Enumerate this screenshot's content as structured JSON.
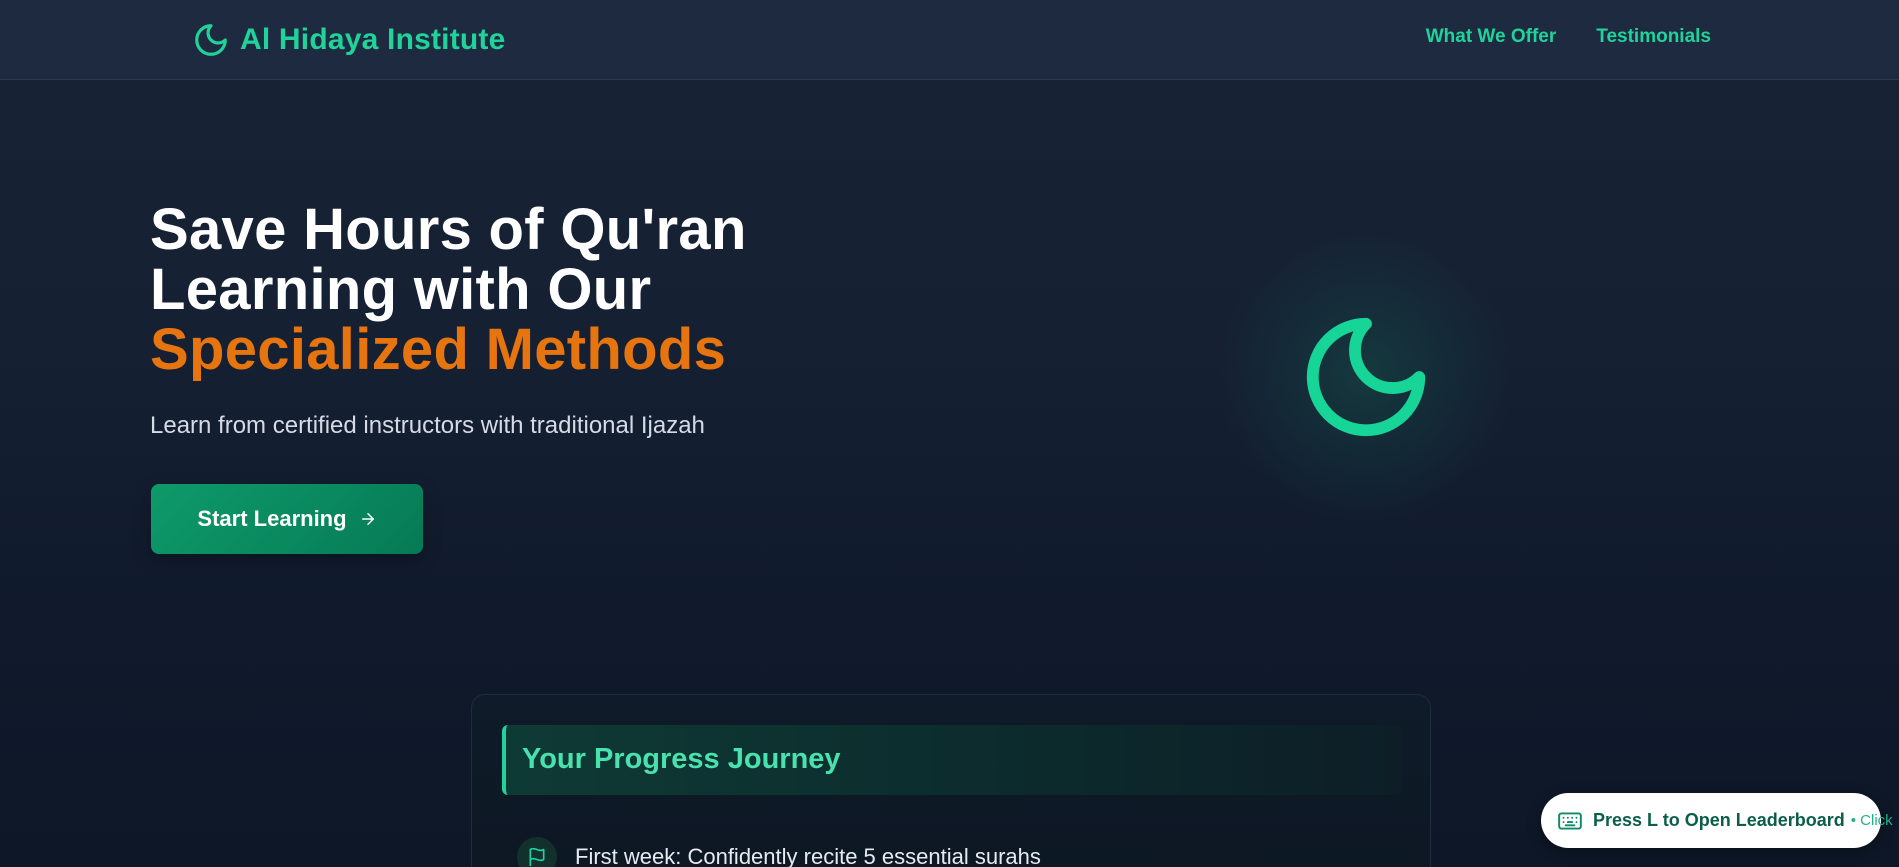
{
  "header": {
    "brand_name": "Al Hidaya Institute",
    "brand_icon": "moon-icon",
    "nav": [
      {
        "label": "What We Offer"
      },
      {
        "label": "Testimonials"
      }
    ]
  },
  "hero": {
    "title_line1": "Save Hours of Qu'ran",
    "title_line2": "Learning with Our",
    "title_accent": "Specialized Methods",
    "subtitle": "Learn from certified instructors with traditional Ijazah",
    "cta_label": "Start Learning",
    "cta_icon": "arrow-right-icon",
    "illustration_icon": "moon-icon"
  },
  "progress": {
    "title": "Your Progress Journey",
    "milestones": [
      {
        "icon": "flag-icon",
        "text": "First week: Confidently recite 5 essential surahs"
      }
    ]
  },
  "leaderboard_pill": {
    "icon": "keyboard-icon",
    "label": "Press L to Open Leaderboard",
    "hint": "• Click"
  },
  "colors": {
    "brand_green": "#1fd39b",
    "accent_orange": "#e6740f",
    "header_bg": "#1e2a3f",
    "cta_green": "#0e9a6a"
  }
}
